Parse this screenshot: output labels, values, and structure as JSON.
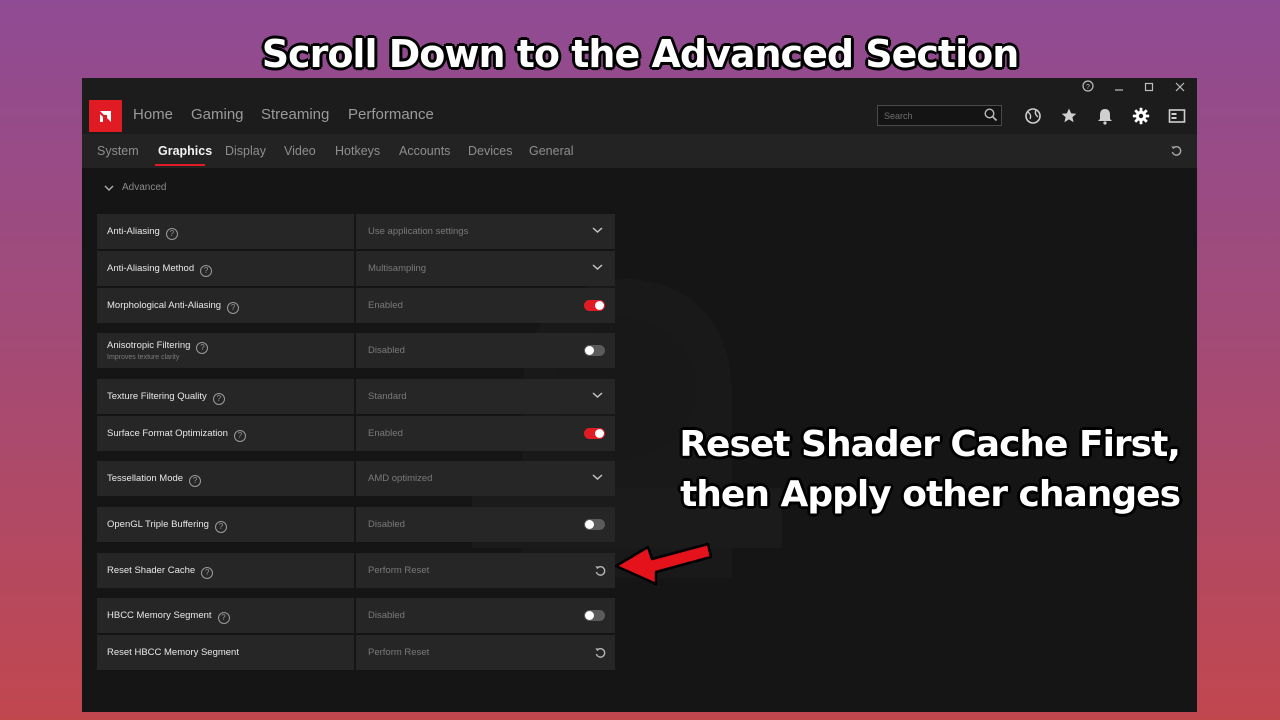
{
  "caption": {
    "title": "Scroll Down to the Advanced Section",
    "callout_line1": "Reset Shader Cache First,",
    "callout_line2": "then Apply other changes"
  },
  "nav": {
    "home": "Home",
    "gaming": "Gaming",
    "streaming": "Streaming",
    "performance": "Performance"
  },
  "search": {
    "placeholder": "Search"
  },
  "tabs": {
    "system": "System",
    "graphics": "Graphics",
    "display": "Display",
    "video": "Video",
    "hotkeys": "Hotkeys",
    "accounts": "Accounts",
    "devices": "Devices",
    "general": "General"
  },
  "section": {
    "title": "Advanced"
  },
  "settings": [
    {
      "label": "Anti-Aliasing",
      "value": "Use application settings"
    },
    {
      "label": "Anti-Aliasing Method",
      "value": "Multisampling"
    },
    {
      "label": "Morphological Anti-Aliasing",
      "value": "Enabled",
      "toggle": true
    },
    {
      "label": "Anisotropic Filtering",
      "description": "Improves texture clarity",
      "value": "Disabled",
      "toggle": false
    },
    {
      "label": "Texture Filtering Quality",
      "value": "Standard"
    },
    {
      "label": "Surface Format Optimization",
      "value": "Enabled",
      "toggle": true
    },
    {
      "label": "Tessellation Mode",
      "value": "AMD optimized"
    },
    {
      "label": "OpenGL Triple Buffering",
      "value": "Disabled",
      "toggle": false
    },
    {
      "label": "Reset Shader Cache",
      "value": "Perform Reset"
    },
    {
      "label": "HBCC Memory Segment",
      "value": "Disabled",
      "toggle": false
    },
    {
      "label": "Reset HBCC Memory Segment",
      "value": "Perform Reset"
    }
  ],
  "colors": {
    "accent": "#e01b24",
    "panel": "#262626",
    "window": "#151515"
  },
  "icons": [
    "help-icon",
    "minimize-icon",
    "maximize-icon",
    "close-icon",
    "search-icon",
    "globe-icon",
    "star-icon",
    "bell-icon",
    "gear-icon",
    "sidebar-icon",
    "reset-icon",
    "chevron-down-icon",
    "question-icon"
  ]
}
